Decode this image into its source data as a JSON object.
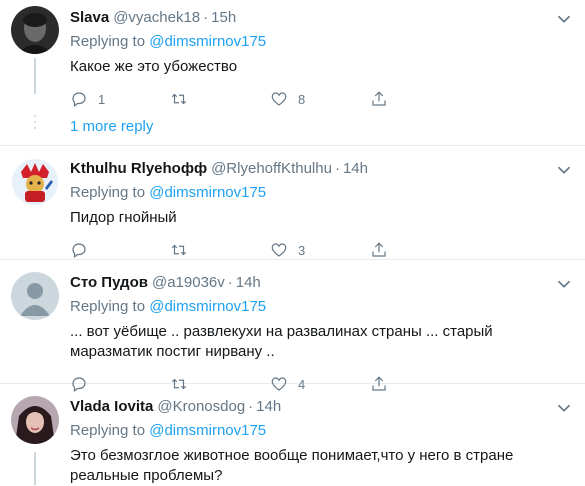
{
  "tweets": [
    {
      "name": "Slava",
      "handle": "@vyachek18",
      "time": "15h",
      "replying_prefix": "Replying to ",
      "mention": "@dimsmirnov175",
      "text": "Какое же это убожество",
      "reply_count": "1",
      "retweet_count": "",
      "like_count": "8"
    },
    {
      "name": "Kthulhu Rlyehoфф",
      "handle": "@RlyehoffKthulhu",
      "time": "14h",
      "replying_prefix": "Replying to ",
      "mention": "@dimsmirnov175",
      "text": "Пидор гнойный",
      "reply_count": "",
      "retweet_count": "",
      "like_count": "3"
    },
    {
      "name": "Сто Пудов",
      "handle": "@a19036v",
      "time": "14h",
      "replying_prefix": "Replying to ",
      "mention": "@dimsmirnov175",
      "text": "... вот уёбище .. развлекухи на развалинах страны ... старый маразматик постиг нирвану ..",
      "reply_count": "",
      "retweet_count": "",
      "like_count": "4"
    },
    {
      "name": "Vlada Iovita",
      "handle": "@Kronosdog",
      "time": "14h",
      "replying_prefix": "Replying to ",
      "mention": "@dimsmirnov175",
      "text": "Это безмозглое животное вообще понимает,что у него в стране реальные проблемы?"
    }
  ],
  "more_replies": "1 more reply",
  "dot": "·",
  "colors": {
    "accent": "#1da1f2",
    "muted": "#657786",
    "text": "#14171a",
    "border": "#e6ecf0"
  }
}
